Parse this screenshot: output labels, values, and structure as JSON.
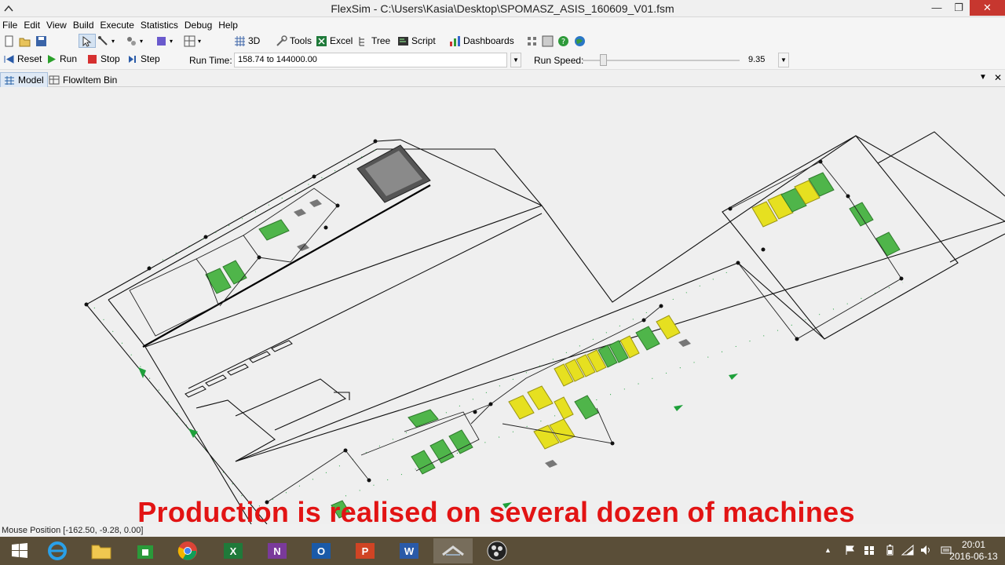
{
  "window": {
    "title": "FlexSim - C:\\Users\\Kasia\\Desktop\\SPOMASZ_ASIS_160609_V01.fsm",
    "minimize_glyph": "—",
    "restore_glyph": "❐",
    "close_glyph": "✕"
  },
  "menu": [
    "File",
    "Edit",
    "View",
    "Build",
    "Execute",
    "Statistics",
    "Debug",
    "Help"
  ],
  "toolbar": {
    "view3d": "3D",
    "tools": "Tools",
    "excel": "Excel",
    "tree": "Tree",
    "script": "Script",
    "dashboards": "Dashboards"
  },
  "run_controls": {
    "reset": "Reset",
    "run": "Run",
    "stop": "Stop",
    "step": "Step",
    "run_time_label": "Run Time:",
    "run_time_value": "158.74  to  144000.00",
    "run_speed_label": "Run Speed:",
    "run_speed_value": "9.35"
  },
  "tabs": {
    "model": "Model",
    "flowitem_bin": "FlowItem Bin"
  },
  "status": {
    "mouse_position": "Mouse Position [-162.50, -9.28, 0.00]"
  },
  "caption": "Production is realised on several dozen of machines",
  "taskbar": {
    "time": "20:01",
    "date": "2016-06-13"
  },
  "colors": {
    "machine_green": "#4fb54a",
    "machine_yellow": "#e6e020",
    "caption_red": "#e21414",
    "taskbar": "#5a4e38"
  }
}
